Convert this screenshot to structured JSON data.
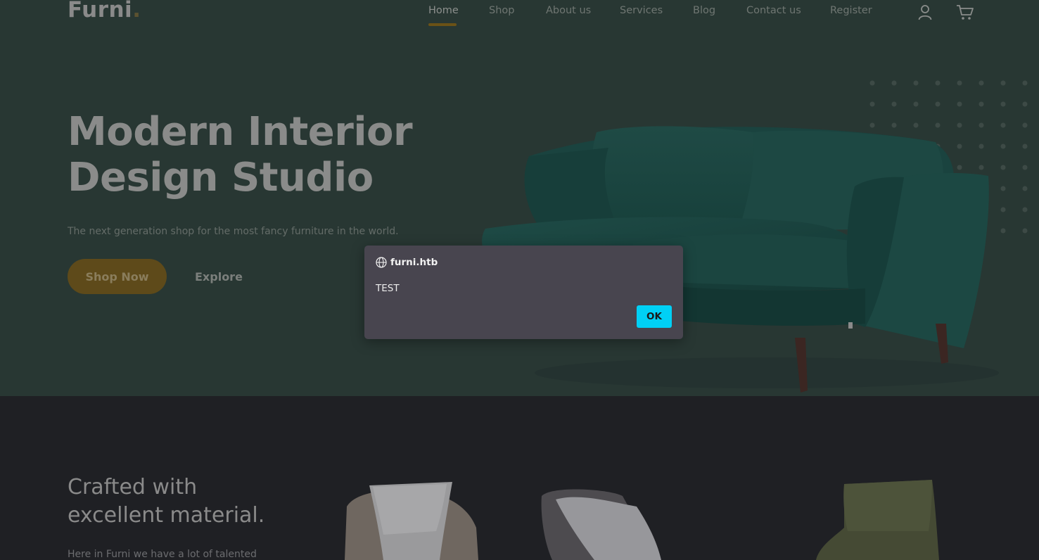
{
  "nav": {
    "logo": "Furni",
    "logo_dot": ".",
    "links": [
      {
        "label": "Home",
        "active": true
      },
      {
        "label": "Shop"
      },
      {
        "label": "About us"
      },
      {
        "label": "Services"
      },
      {
        "label": "Blog"
      },
      {
        "label": "Contact us"
      },
      {
        "label": "Register"
      }
    ],
    "icons": [
      "user-icon",
      "cart-icon"
    ]
  },
  "hero": {
    "title_line1": "Modern Interior",
    "title_line2": "Design Studio",
    "subtitle": "The next generation shop for the most fancy furniture in the world.",
    "primary_button": "Shop Now",
    "secondary_button": "Explore"
  },
  "section": {
    "title_line1": "Crafted with",
    "title_line2": "excellent material.",
    "text": "Here in Furni we have a lot of talented"
  },
  "dialog": {
    "origin": "furni.htb",
    "message": "TEST",
    "ok_label": "OK"
  },
  "colors": {
    "hero_bg": "#283733",
    "page_bg": "#1f2024",
    "accent": "#6b5216",
    "dialog_bg": "#48454f",
    "ok_button": "#00d0f5"
  }
}
